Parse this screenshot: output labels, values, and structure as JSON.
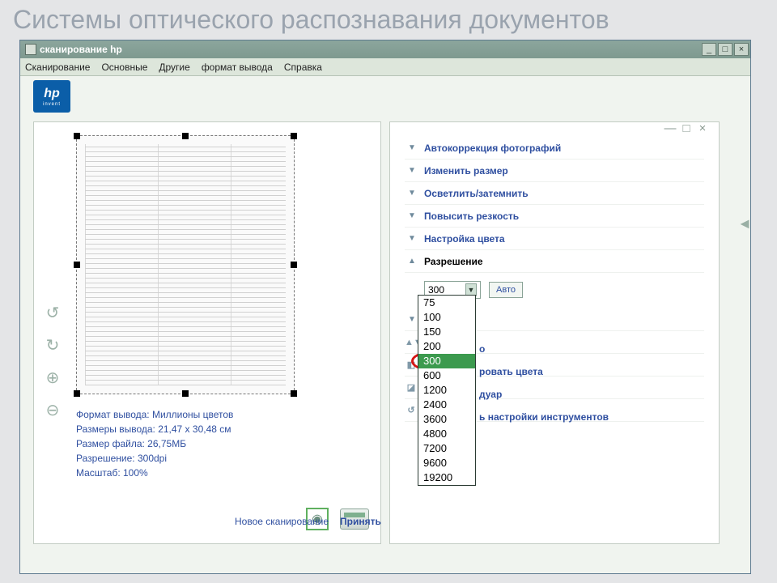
{
  "slide_title": "Системы оптического распознавания документов",
  "window": {
    "title": "сканирование hp",
    "minimize": "_",
    "maximize": "□",
    "close": "×"
  },
  "menu": {
    "scanning": "Сканирование",
    "basic": "Основные",
    "other": "Другие",
    "output_format": "формат вывода",
    "help": "Справка"
  },
  "logo": {
    "hp": "hp",
    "invent": "invent"
  },
  "left": {
    "info": {
      "output_format": "Формат вывода: Миллионы цветов",
      "output_size": "Размеры вывода: 21,47 x 30,48 см",
      "file_size": "Размер файла: 26,75МБ",
      "resolution": "Разрешение:  300dpi",
      "scale": "Масштаб: 100%"
    },
    "new_scan": "Новое сканирование",
    "accept": "Принять"
  },
  "tools": {
    "rotate_l": "↺",
    "rotate_r": "↻",
    "zoom_in": "⊕",
    "zoom_out": "⊖"
  },
  "right": {
    "acc": {
      "auto_correct": "Автокоррекция фотографий",
      "resize": "Изменить размер",
      "lighten": "Осветлить/затемнить",
      "sharpen": "Повысить резкость",
      "color_adjust": "Настройка цвета",
      "resolution": "Разрешение",
      "auto_btn": "Авто",
      "selected_value": "300"
    },
    "peek": {
      "end_o": "о",
      "colors": "ровать цвета",
      "duar": "дуар",
      "tool_settings": "ь настройки инструментов"
    },
    "options": [
      "75",
      "100",
      "150",
      "200",
      "300",
      "600",
      "1200",
      "2400",
      "3600",
      "4800",
      "7200",
      "9600",
      "19200"
    ],
    "selected_index": 4
  },
  "sub_win": {
    "min": "—",
    "max": "□",
    "close": "×"
  }
}
